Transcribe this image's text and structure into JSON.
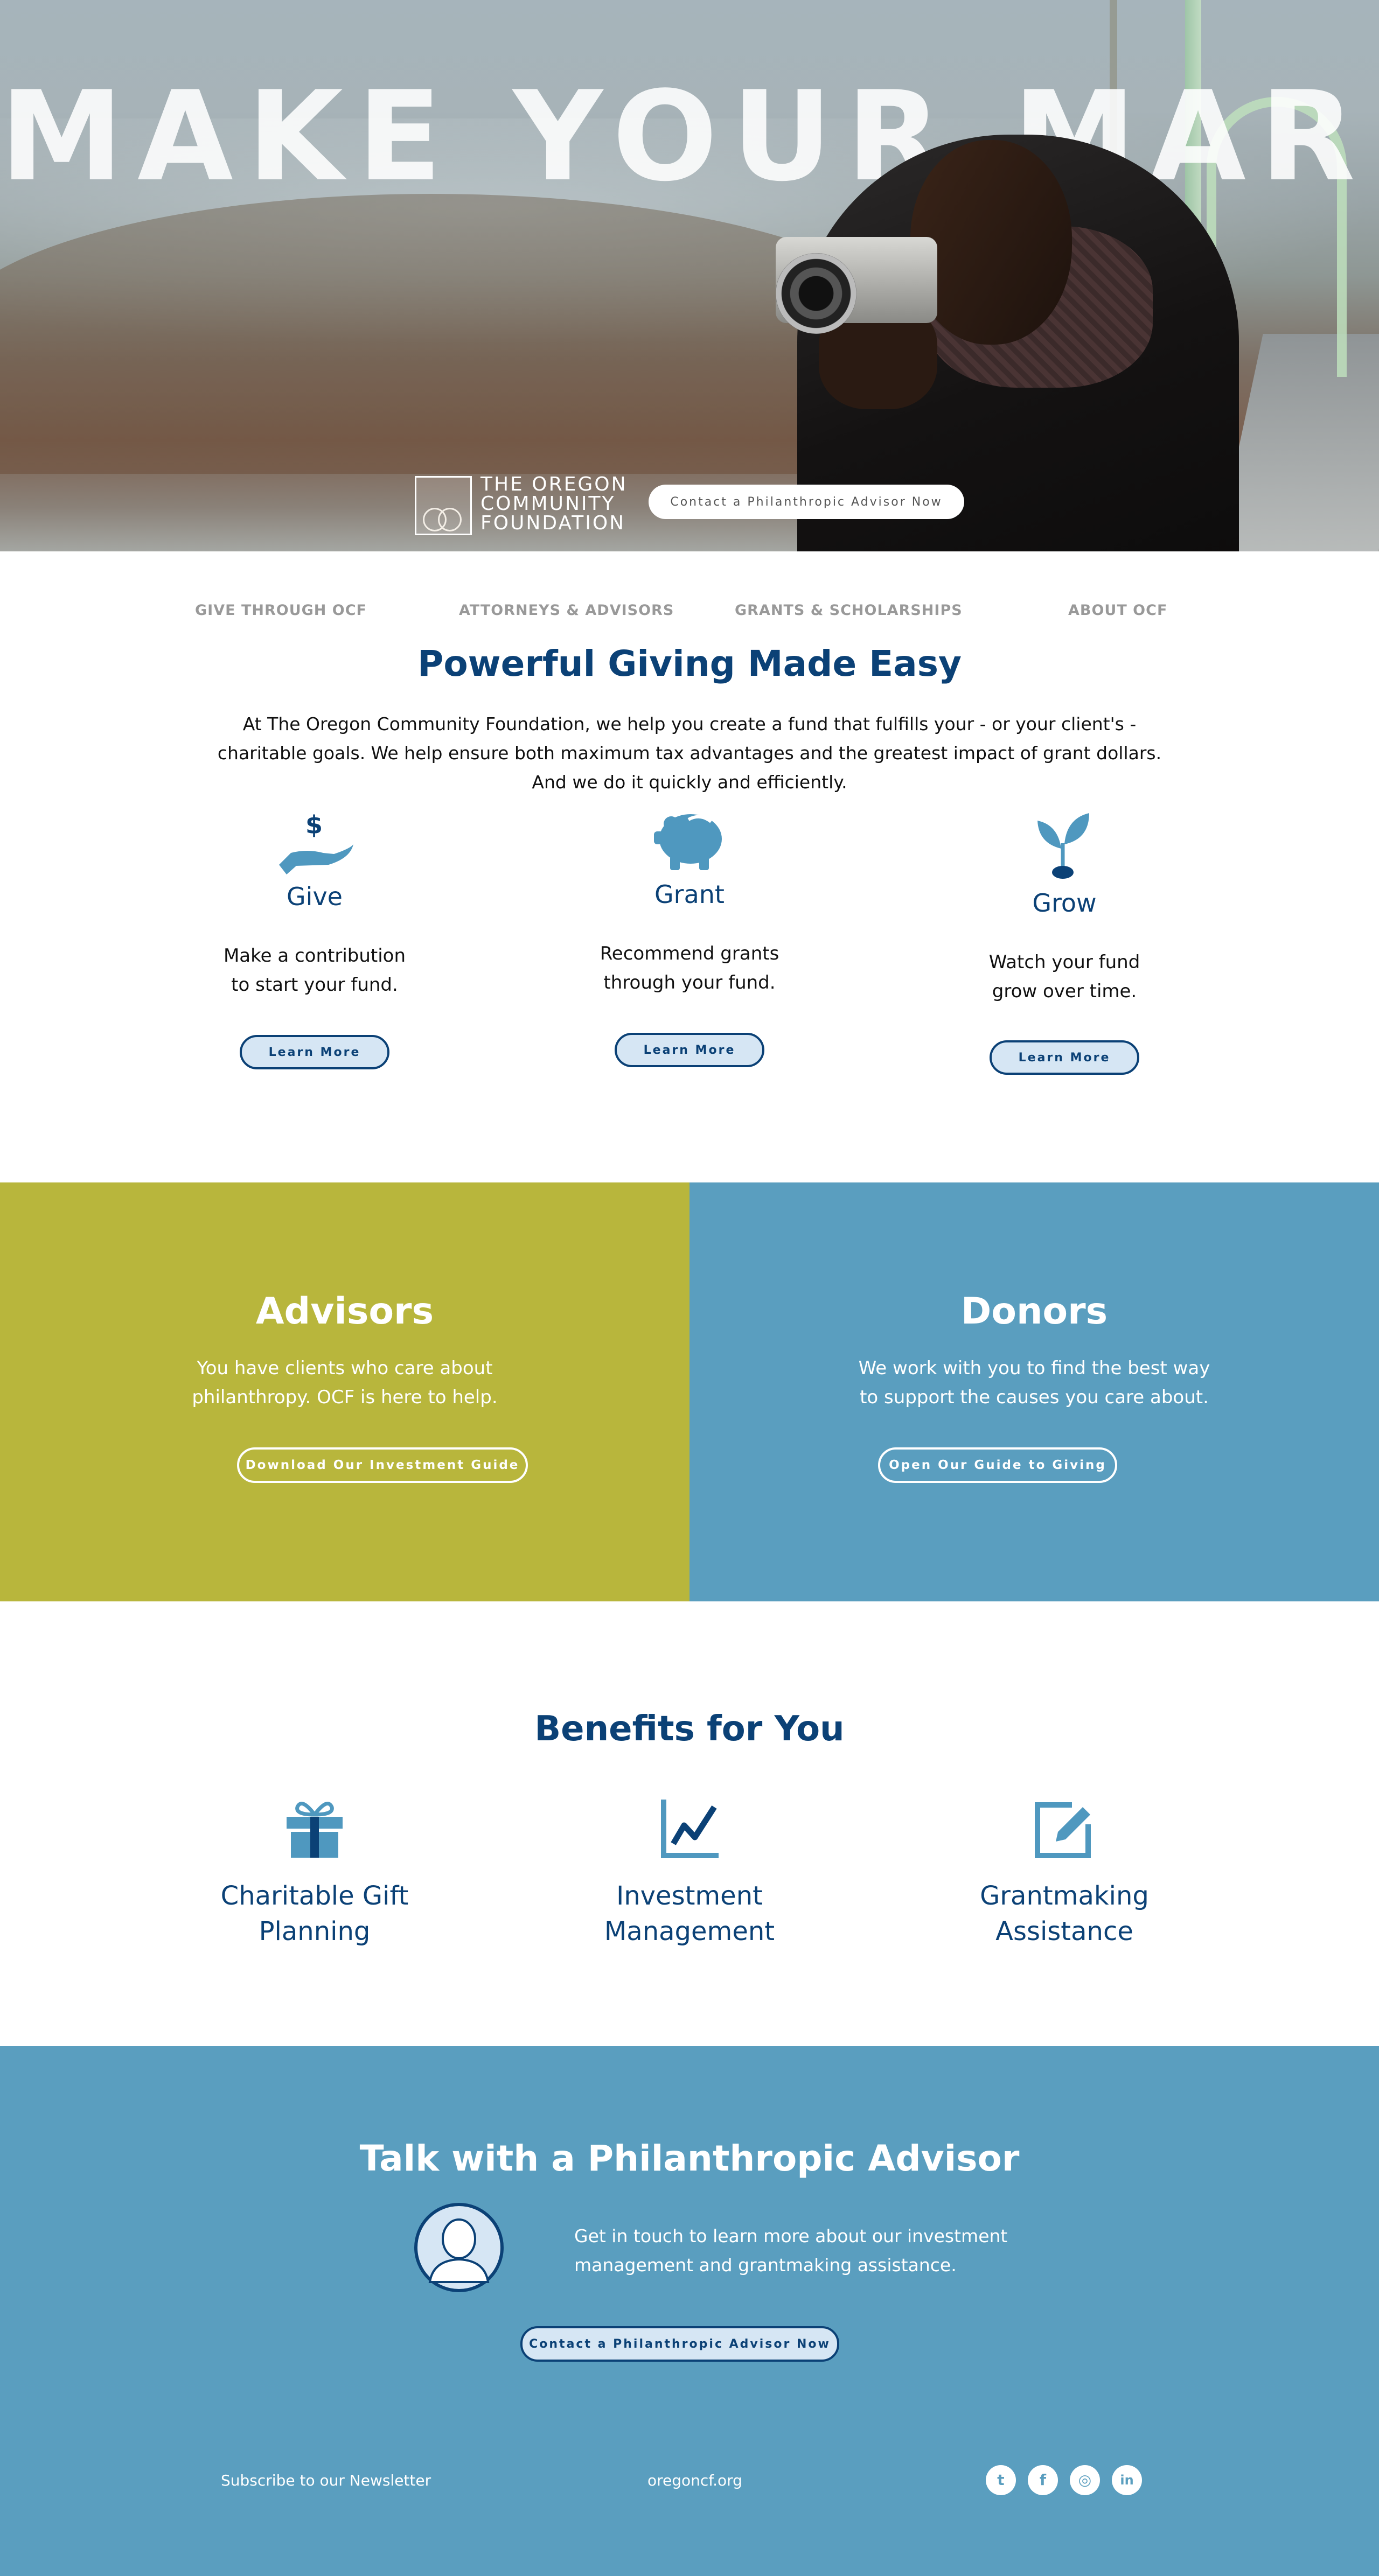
{
  "hero": {
    "title": "MAKE YOUR MARK",
    "logo_line1": "THE OREGON",
    "logo_line2": "COMMUNITY",
    "logo_line3": "FOUNDATION",
    "logo_mark": "OCF",
    "cta": "Contact a Philanthropic Advisor Now"
  },
  "nav": {
    "items": [
      "GIVE THROUGH OCF",
      "ATTORNEYS & ADVISORS",
      "GRANTS & SCHOLARSHIPS",
      "ABOUT OCF"
    ]
  },
  "intro": {
    "heading": "Powerful Giving Made Easy",
    "text": "At The Oregon Community Foundation, we help you create a fund that fulfills your - or your client's - charitable goals. We help ensure both maximum tax advantages and the greatest impact of grant dollars. And we do it quickly and efficiently."
  },
  "features": [
    {
      "icon": "hand-dollar-icon",
      "title": "Give",
      "line1": "Make a contribution",
      "line2": "to start your fund.",
      "button": "Learn More"
    },
    {
      "icon": "piggy-bank-icon",
      "title": "Grant",
      "line1": "Recommend grants",
      "line2": "through your fund.",
      "button": "Learn More"
    },
    {
      "icon": "sprout-icon",
      "title": "Grow",
      "line1": "Watch your fund",
      "line2": "grow over time.",
      "button": "Learn More"
    }
  ],
  "advisors": {
    "heading": "Advisors",
    "line1": "You have clients who care about",
    "line2": "philanthropy. OCF is here to help.",
    "button": "Download Our Investment Guide",
    "color": "#b8b63c"
  },
  "donors": {
    "heading": "Donors",
    "line1": "We work with you to find the best way",
    "line2": "to support the causes you care about.",
    "button": "Open Our Guide to Giving",
    "color": "#5a9ebf"
  },
  "benefits": {
    "heading": "Benefits for You",
    "items": [
      {
        "icon": "gift-icon",
        "line1": "Charitable Gift",
        "line2": "Planning"
      },
      {
        "icon": "chart-icon",
        "line1": "Investment",
        "line2": "Management"
      },
      {
        "icon": "edit-icon",
        "line1": "Grantmaking",
        "line2": "Assistance"
      }
    ]
  },
  "contact": {
    "heading": "Talk with a Philanthropic Advisor",
    "line1": "Get in touch to learn more about our investment",
    "line2": "management and grantmaking assistance.",
    "button": "Contact a Philanthropic Advisor Now"
  },
  "footer": {
    "newsletter": "Subscribe to our Newsletter",
    "site": "oregoncf.org",
    "social": [
      {
        "icon": "twitter-icon",
        "glyph": "t"
      },
      {
        "icon": "facebook-icon",
        "glyph": "f"
      },
      {
        "icon": "instagram-icon",
        "glyph": "◎"
      },
      {
        "icon": "linkedin-icon",
        "glyph": "in"
      }
    ]
  },
  "colors": {
    "brand_navy": "#0b4176",
    "brand_blue": "#5a9ebf",
    "brand_olive": "#b8b63c",
    "icon_blue": "#4f98bf"
  }
}
